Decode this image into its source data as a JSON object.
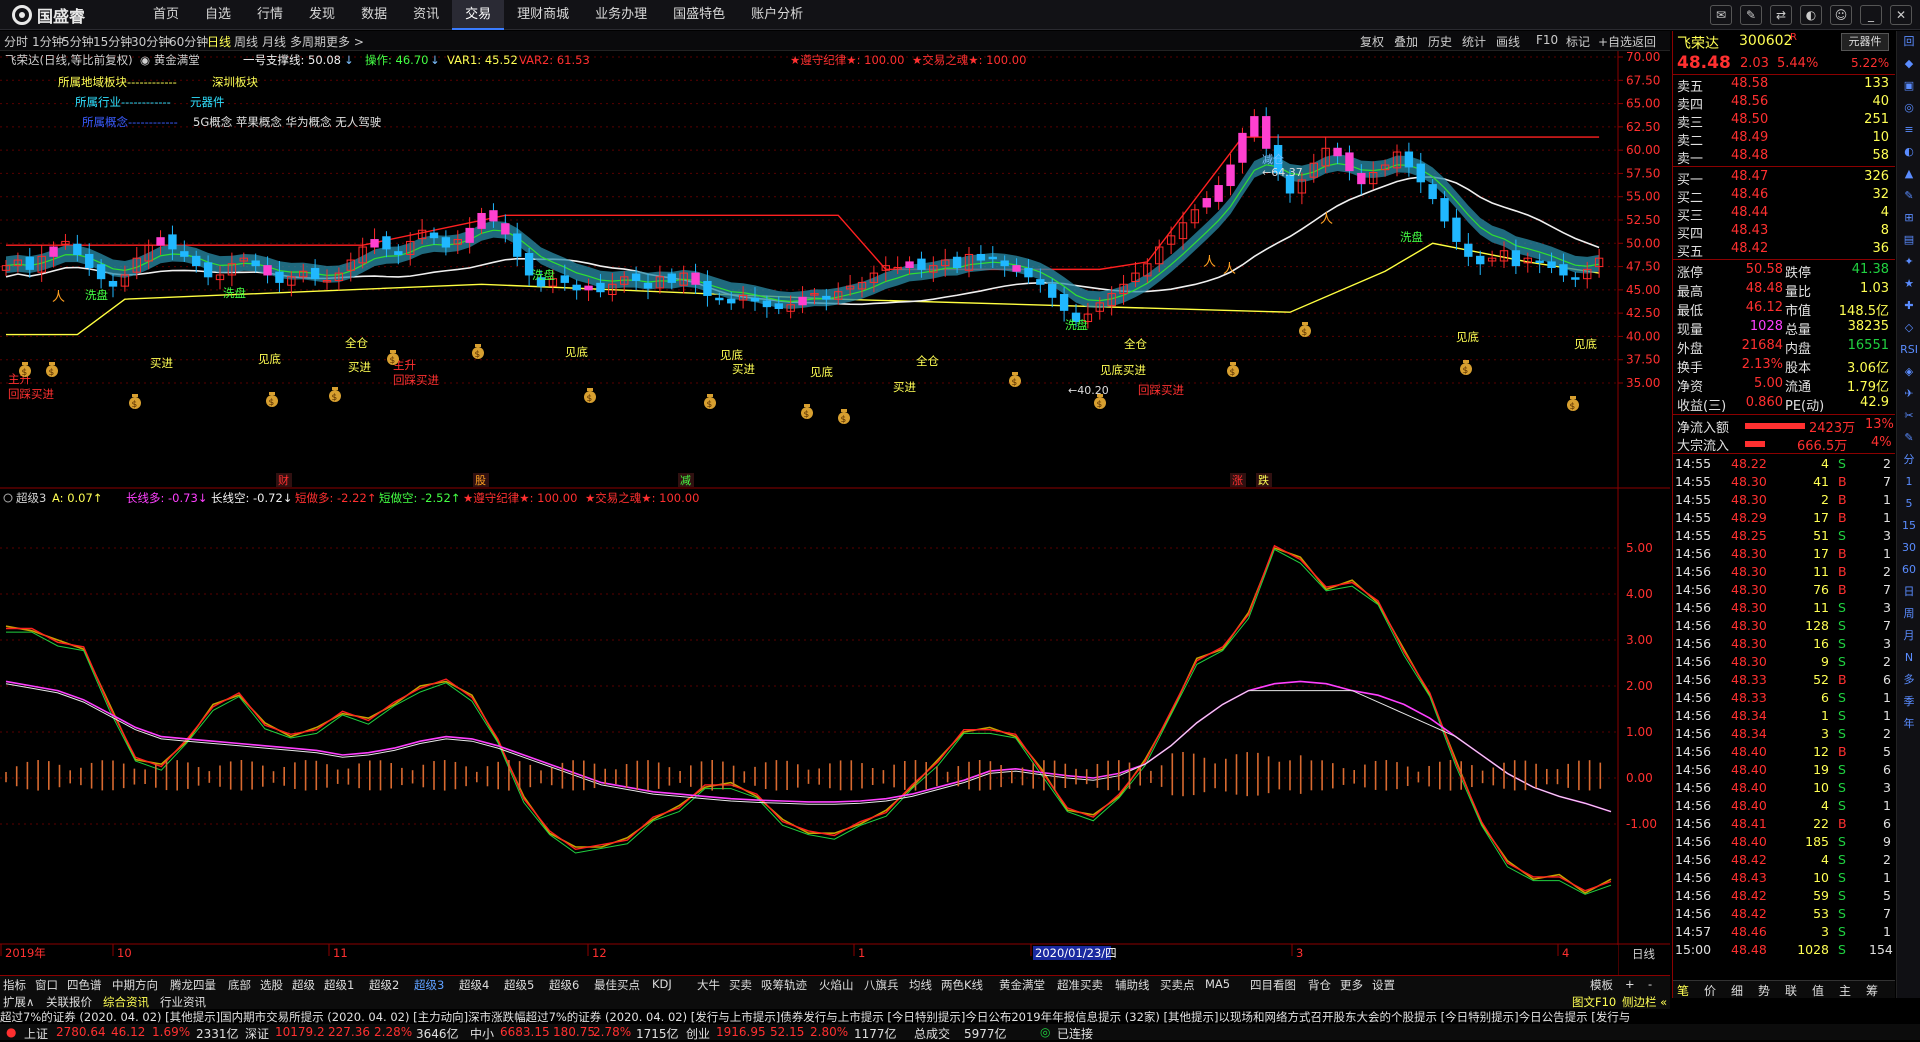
{
  "app": {
    "logo": "国盛睿",
    "nav": [
      "首页",
      "自选",
      "行情",
      "发现",
      "数据",
      "资讯",
      "交易",
      "理财商城",
      "业务办理",
      "国盛特色",
      "账户分析"
    ],
    "active_nav": "交易",
    "window_icons": [
      "消息",
      "编辑",
      "切换",
      "皮肤",
      "用户",
      "最小化",
      "关闭"
    ]
  },
  "periods": [
    "分时",
    "1分钟",
    "5分钟",
    "15分钟",
    "30分钟",
    "60分钟",
    "日线",
    "周线",
    "月线",
    "多周期",
    "更多 >"
  ],
  "active_period": "日线",
  "chart_tools": [
    "复权",
    "叠加",
    "历史",
    "统计",
    "画线",
    "F10",
    "标记",
    "+自选",
    "返回"
  ],
  "main_header": {
    "name": "飞荣达(日线,等比前复权)",
    "indicator": "◉ 黄金满堂",
    "support": "一号支撑线: 50.08",
    "support_arrow": "↓",
    "op": "操作: 46.70",
    "op_arrow": "↓",
    "var1": "VAR1: 45.52",
    "var2": "VAR2: 61.53",
    "discipline": "★遵守纪律★: 100.00",
    "soul": "★交易之魂★: 100.00"
  },
  "info_block": {
    "region_label": "所属地域板块------------",
    "region_value": "深圳板块",
    "industry_label": "所属行业------------",
    "industry_value": "元器件",
    "concept_label": "所属概念------------",
    "concept_value": "5G概念 苹果概念 华为概念 无人驾驶"
  },
  "main_axis": [
    "70.00",
    "67.50",
    "65.00",
    "62.50",
    "60.00",
    "57.50",
    "55.00",
    "52.50",
    "50.00",
    "47.50",
    "45.00",
    "42.50",
    "40.00",
    "37.50",
    "35.00"
  ],
  "annotations": {
    "high": "64.37",
    "low": "40.20",
    "reduce": "减仓"
  },
  "chart_labels": [
    {
      "t": "洗盘",
      "c": "#44ff44"
    },
    {
      "t": "洗盘",
      "c": "#44ff44"
    },
    {
      "t": "洗盘",
      "c": "#44ff44"
    },
    {
      "t": "洗盘",
      "c": "#44ff44"
    },
    {
      "t": "洗盘",
      "c": "#44ff44"
    },
    {
      "t": "主升",
      "c": "#ff3030"
    },
    {
      "t": "回踩买进",
      "c": "#ff3030"
    },
    {
      "t": "买进",
      "c": "#ffff54"
    },
    {
      "t": "全仓",
      "c": "#ffff54"
    },
    {
      "t": "见底",
      "c": "#ffff54"
    },
    {
      "t": "买进",
      "c": "#ffff54"
    },
    {
      "t": "主升",
      "c": "#ff3030"
    },
    {
      "t": "回踩买进",
      "c": "#ff3030"
    },
    {
      "t": "见底",
      "c": "#ffff54"
    },
    {
      "t": "见底",
      "c": "#ffff54"
    },
    {
      "t": "买进",
      "c": "#ffff54"
    },
    {
      "t": "见底",
      "c": "#ffff54"
    },
    {
      "t": "全仓",
      "c": "#ffff54"
    },
    {
      "t": "买进",
      "c": "#ffff54"
    },
    {
      "t": "见底买进",
      "c": "#ffff54"
    },
    {
      "t": "全仓",
      "c": "#ffff54"
    },
    {
      "t": "回踩买进",
      "c": "#ff3030"
    },
    {
      "t": "见底",
      "c": "#ffff54"
    },
    {
      "t": "见底",
      "c": "#ffff54"
    }
  ],
  "event_markers": [
    "财",
    "股",
    "减",
    "涨",
    "跌"
  ],
  "sub_header": {
    "name": "超级3",
    "a": "A: 0.07↑",
    "long_more": "长线多: -0.73↓",
    "long_empty": "长线空: -0.72↓",
    "short_more": "短做多: -2.22↑",
    "short_empty": "短做空: -2.52↑",
    "discipline": "★遵守纪律★: 100.00",
    "soul": "★交易之魂★: 100.00"
  },
  "sub_axis": [
    "5.00",
    "4.00",
    "3.00",
    "2.00",
    "1.00",
    "0.00",
    "-1.00"
  ],
  "time_axis": [
    "2019年",
    "10",
    "11",
    "12",
    "1",
    "2020/01/23/四",
    "3",
    "4"
  ],
  "time_axis_right": "日线",
  "quote": {
    "name": "飞荣达",
    "code": "300602",
    "flag": "R",
    "tool": "元器件",
    "price": "48.48",
    "change": "2.03",
    "pct": "5.44%",
    "amp": "5.22%",
    "sell": [
      [
        "卖五",
        "48.58",
        "133"
      ],
      [
        "卖四",
        "48.56",
        "40"
      ],
      [
        "卖三",
        "48.50",
        "251"
      ],
      [
        "卖二",
        "48.49",
        "10"
      ],
      [
        "卖一",
        "48.48",
        "58"
      ]
    ],
    "buy": [
      [
        "买一",
        "48.47",
        "326"
      ],
      [
        "买二",
        "48.46",
        "32"
      ],
      [
        "买三",
        "48.44",
        "4"
      ],
      [
        "买四",
        "48.43",
        "8"
      ],
      [
        "买五",
        "48.42",
        "36"
      ]
    ],
    "stats": [
      [
        "涨停",
        "50.58",
        "跌停",
        "41.38"
      ],
      [
        "最高",
        "48.48",
        "量比",
        "1.03"
      ],
      [
        "最低",
        "46.12",
        "市值",
        "148.5亿"
      ],
      [
        "现量",
        "1028",
        "总量",
        "38235"
      ],
      [
        "外盘",
        "21684",
        "内盘",
        "16551"
      ],
      [
        "换手",
        "2.13%",
        "股本",
        "3.06亿"
      ],
      [
        "净资",
        "5.00",
        "流通",
        "1.79亿"
      ],
      [
        "收益(三)",
        "0.860",
        "PE(动)",
        "42.9"
      ]
    ],
    "inflow": {
      "label": "净流入额",
      "value": "2423万",
      "pct": "13%",
      "big_label": "大宗流入",
      "big_value": "666.5万",
      "big_pct": "4%"
    }
  },
  "ticks": [
    [
      "14:55",
      "48.22",
      "4",
      "S",
      "2"
    ],
    [
      "14:55",
      "48.30",
      "41",
      "B",
      "7"
    ],
    [
      "14:55",
      "48.30",
      "2",
      "B",
      "1"
    ],
    [
      "14:55",
      "48.29",
      "17",
      "B",
      "1"
    ],
    [
      "14:55",
      "48.25",
      "51",
      "S",
      "3"
    ],
    [
      "14:56",
      "48.30",
      "17",
      "B",
      "1"
    ],
    [
      "14:56",
      "48.30",
      "11",
      "B",
      "2"
    ],
    [
      "14:56",
      "48.30",
      "76",
      "B",
      "7"
    ],
    [
      "14:56",
      "48.30",
      "11",
      "S",
      "3"
    ],
    [
      "14:56",
      "48.30",
      "128",
      "S",
      "7"
    ],
    [
      "14:56",
      "48.30",
      "16",
      "S",
      "3"
    ],
    [
      "14:56",
      "48.30",
      "9",
      "S",
      "2"
    ],
    [
      "14:56",
      "48.33",
      "52",
      "B",
      "6"
    ],
    [
      "14:56",
      "48.33",
      "6",
      "S",
      "1"
    ],
    [
      "14:56",
      "48.34",
      "1",
      "S",
      "1"
    ],
    [
      "14:56",
      "48.34",
      "3",
      "S",
      "2"
    ],
    [
      "14:56",
      "48.40",
      "12",
      "B",
      "5"
    ],
    [
      "14:56",
      "48.40",
      "19",
      "S",
      "6"
    ],
    [
      "14:56",
      "48.40",
      "10",
      "S",
      "3"
    ],
    [
      "14:56",
      "48.40",
      "4",
      "S",
      "1"
    ],
    [
      "14:56",
      "48.41",
      "22",
      "B",
      "6"
    ],
    [
      "14:56",
      "48.40",
      "185",
      "S",
      "9"
    ],
    [
      "14:56",
      "48.42",
      "4",
      "S",
      "2"
    ],
    [
      "14:56",
      "48.43",
      "10",
      "S",
      "1"
    ],
    [
      "14:56",
      "48.42",
      "59",
      "S",
      "5"
    ],
    [
      "14:56",
      "48.42",
      "53",
      "S",
      "7"
    ],
    [
      "14:57",
      "48.46",
      "3",
      "S",
      "1"
    ],
    [
      "15:00",
      "48.48",
      "1028",
      "S",
      "154"
    ]
  ],
  "sidebar": [
    "回",
    "◆",
    "▣",
    "◎",
    "≡",
    "◐",
    "▲",
    "✎",
    "⊞",
    "▤",
    "✦",
    "★",
    "✚",
    "◇",
    "RSI",
    "◈",
    "✈",
    "✂",
    "✎",
    "分",
    "1",
    "5",
    "15",
    "30",
    "60",
    "日",
    "周",
    "月",
    "N",
    "多",
    "季",
    "年"
  ],
  "tabs1": [
    "指标",
    "窗口",
    "四色谱",
    "中期方向",
    "腾龙四量",
    "底部",
    "选股",
    "超级",
    "超级1",
    "超级2",
    "超级3",
    "超级4",
    "超级5",
    "超级6",
    "最佳买点",
    "KDJ",
    "大牛",
    "买卖",
    "吸筹轨迹",
    "火焰山",
    "八旗兵",
    "均线",
    "两色K线",
    "黄金满堂",
    "超准买卖",
    "辅助线",
    "买卖点",
    "MA5",
    "四目看图",
    "背仓",
    "更多",
    "设置"
  ],
  "active_tab1": "超级3",
  "tabs1_right": [
    "模板",
    "+",
    "-"
  ],
  "tabs2": [
    "扩展∧",
    "关联报价",
    "综合资讯",
    "行业资讯"
  ],
  "tabs2_right": [
    "图文F10",
    "侧边栏 «"
  ],
  "rp_tabs": [
    "笔",
    "价",
    "细",
    "势",
    "联",
    "值",
    "主",
    "筹"
  ],
  "news": "超过7%的证券 (2020. 04. 02)    [其他提示]国内期市交易所提示 (2020. 04. 02)    [主力动向]深市涨跌幅超过7%的证券 (2020. 04. 02)    [发行与上市提示]债券发行与上市提示    [今日特别提示]今日公布2019年年报信息提示 (32家)    [其他提示]以现场和网络方式召开股东大会的个股提示    [今日特别提示]今日公告提示    [发行与",
  "status": {
    "sh_label": "上证",
    "sh": "2780.64",
    "sh_chg": "46.12",
    "sh_pct": "1.69%",
    "sh_amt": "2331亿",
    "sz_label": "深证",
    "sz": "10179.2",
    "sz_chg": "227.36",
    "sz_pct": "2.28%",
    "sz_amt": "3646亿",
    "zx_label": "中小",
    "zx": "6683.15",
    "zx_chg": "180.75",
    "zx_pct": "2.78%",
    "zx_amt": "1715亿",
    "cy_label": "创业",
    "cy": "1916.95",
    "cy_chg": "52.15",
    "cy_pct": "2.80%",
    "cy_amt": "1177亿",
    "total_label": "总成交",
    "total": "5977亿",
    "conn": "已连接"
  }
}
